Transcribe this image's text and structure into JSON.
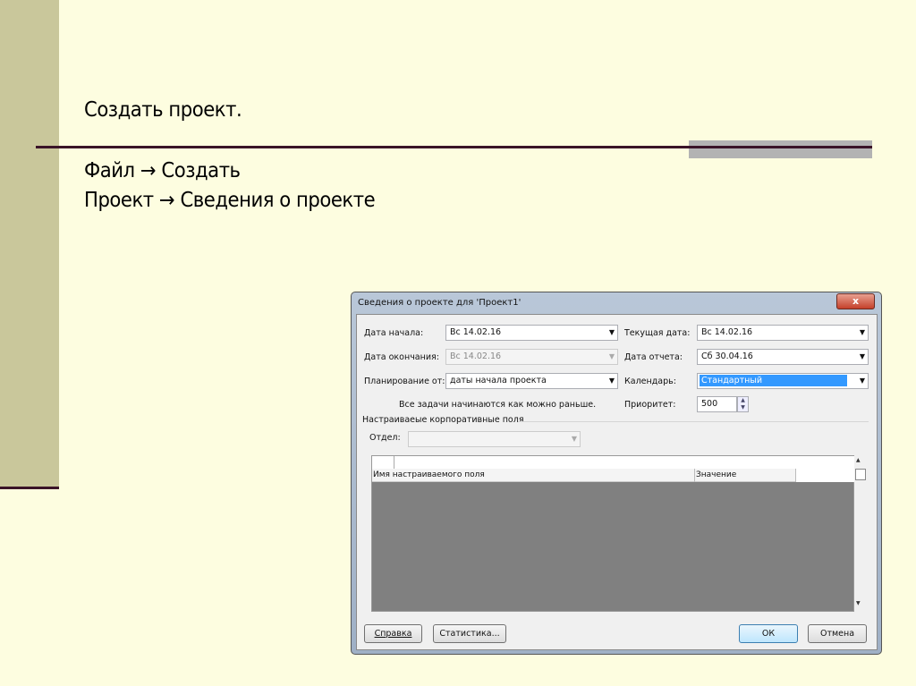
{
  "slide": {
    "title": "Создать проект.",
    "line1": "Файл → Создать",
    "line2": "Проект → Сведения о проекте"
  },
  "dialog": {
    "title": "Сведения о проекте для 'Проект1'",
    "close": "x",
    "start_date": {
      "label": "Дата начала:",
      "value": "Вс 14.02.16"
    },
    "end_date": {
      "label": "Дата окончания:",
      "value": "Вс 14.02.16"
    },
    "schedule_from": {
      "label": "Планирование от:",
      "value": "даты начала проекта"
    },
    "current_date": {
      "label": "Текущая дата:",
      "value": "Вс 14.02.16"
    },
    "status_date": {
      "label": "Дата отчета:",
      "value": "Сб 30.04.16"
    },
    "calendar": {
      "label": "Календарь:",
      "value": "Стандартный"
    },
    "priority": {
      "label": "Приоритет:",
      "value": "500"
    },
    "note": "Все задачи начинаются как можно раньше.",
    "custom_fields_group": "Настраиваеые корпоративные поля",
    "department": {
      "label": "Отдел:",
      "value": ""
    },
    "grid": {
      "columns": [
        "Имя настраиваемого поля",
        "Значение"
      ]
    },
    "buttons": {
      "help": "Справка",
      "stats": "Статистика...",
      "ok": "ОК",
      "cancel": "Отмена"
    }
  }
}
